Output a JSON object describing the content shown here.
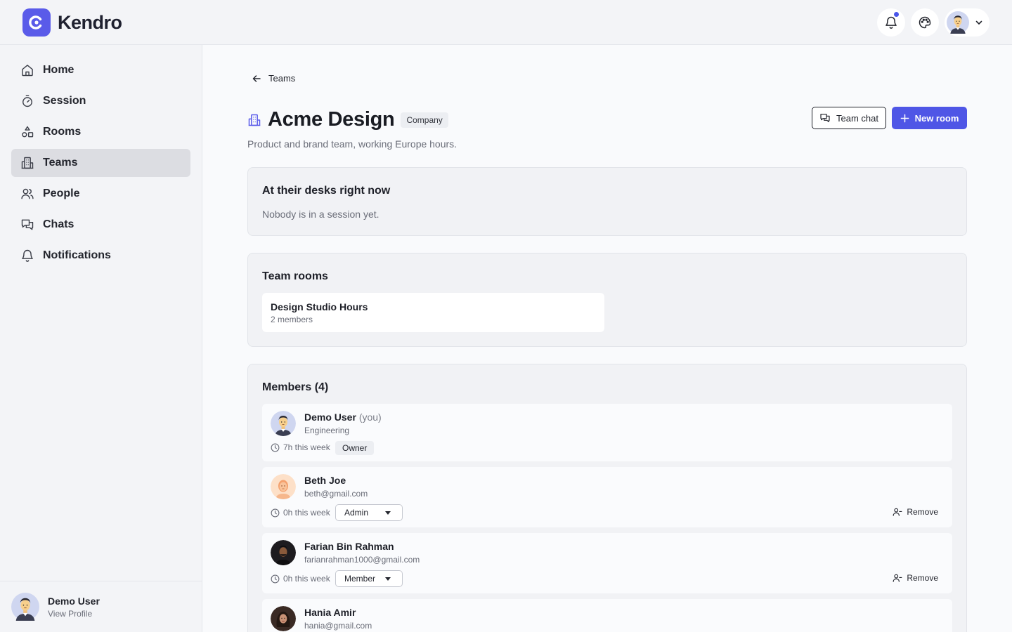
{
  "app": {
    "name": "Kendro"
  },
  "sidebar": {
    "items": [
      {
        "label": "Home",
        "icon": "home-icon"
      },
      {
        "label": "Session",
        "icon": "timer-icon"
      },
      {
        "label": "Rooms",
        "icon": "rooms-icon"
      },
      {
        "label": "Teams",
        "icon": "building-icon",
        "active": true
      },
      {
        "label": "People",
        "icon": "people-icon"
      },
      {
        "label": "Chats",
        "icon": "chat-icon"
      },
      {
        "label": "Notifications",
        "icon": "bell-icon"
      }
    ],
    "footer": {
      "name": "Demo User",
      "sub": "View Profile"
    }
  },
  "header": {
    "notifications_unread": true
  },
  "breadcrumb": {
    "label": "Teams"
  },
  "team": {
    "name": "Acme Design",
    "type_badge": "Company",
    "description": "Product and brand team, working Europe hours.",
    "team_chat_label": "Team chat",
    "new_room_label": "New room"
  },
  "desks": {
    "title": "At their desks right now",
    "empty": "Nobody is in a session yet."
  },
  "rooms": {
    "title": "Team rooms",
    "items": [
      {
        "name": "Design Studio Hours",
        "meta": "2 members"
      }
    ]
  },
  "members": {
    "title": "Members (4)",
    "items": [
      {
        "name": "Demo User",
        "you": "(you)",
        "sub": "Engineering",
        "time": "7h this week",
        "role": "Owner"
      },
      {
        "name": "Beth Joe",
        "sub": "beth@gmail.com",
        "time": "0h this week",
        "role": "Admin",
        "remove": "Remove"
      },
      {
        "name": "Farian Bin Rahman",
        "sub": "farianrahman1000@gmail.com",
        "time": "0h this week",
        "role": "Member",
        "remove": "Remove"
      },
      {
        "name": "Hania Amir",
        "sub": "hania@gmail.com"
      }
    ]
  },
  "colors": {
    "accent": "#4f56e6",
    "logo": "#5a5be9"
  }
}
